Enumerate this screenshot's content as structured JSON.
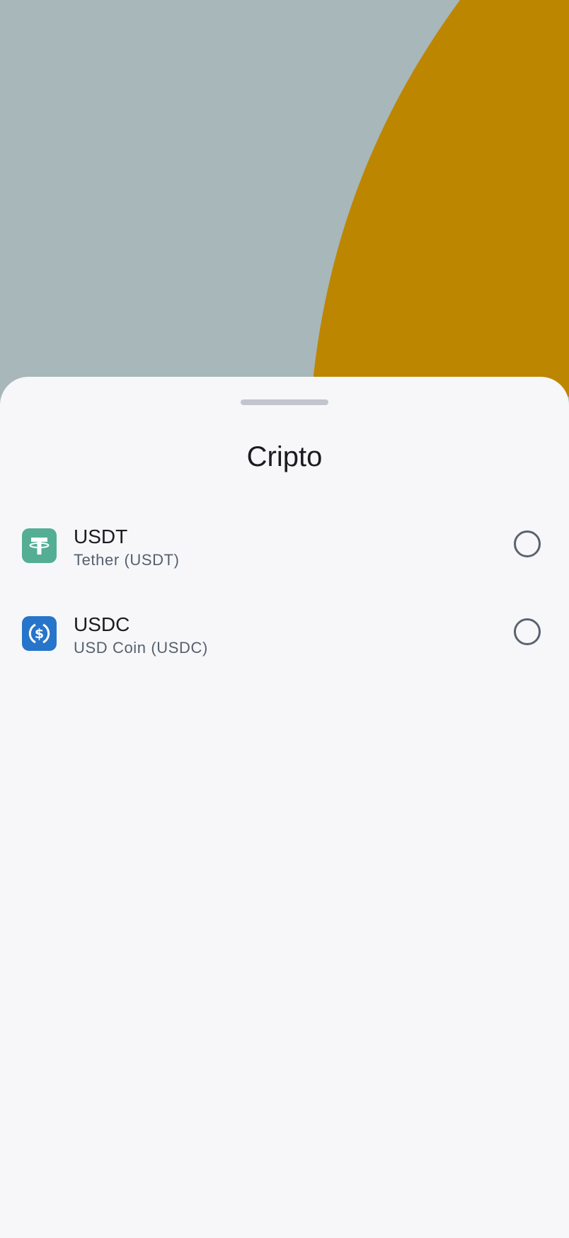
{
  "sheet": {
    "title": "Cripto"
  },
  "colors": {
    "backdrop": "#a7b7ba",
    "accent_shape": "#bd8600",
    "sheet_background": "#f7f7f9",
    "usdt_brand": "#53ae94",
    "usdc_brand": "#2775ca"
  },
  "items": [
    {
      "symbol": "USDT",
      "description": "Tether (USDT)",
      "icon": "tether-icon",
      "selected": false
    },
    {
      "symbol": "USDC",
      "description": "USD Coin (USDC)",
      "icon": "usd-coin-icon",
      "selected": false
    }
  ]
}
